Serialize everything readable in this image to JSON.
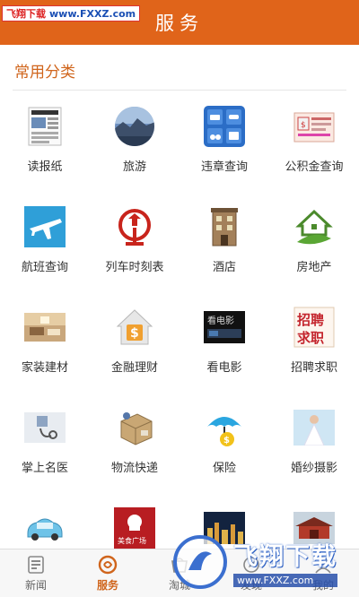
{
  "header": {
    "title": "服务"
  },
  "watermark_top": {
    "brand": "飞翔下载",
    "site": "www.FXXZ.com"
  },
  "section": {
    "title": "常用分类"
  },
  "categories": [
    {
      "label": "读报纸",
      "icon": "newspaper-icon"
    },
    {
      "label": "旅游",
      "icon": "travel-photo-icon"
    },
    {
      "label": "违章查询",
      "icon": "traffic-violation-icon"
    },
    {
      "label": "公积金查询",
      "icon": "housing-fund-icon"
    },
    {
      "label": "航班查询",
      "icon": "airplane-icon"
    },
    {
      "label": "列车时刻表",
      "icon": "railway-logo-icon"
    },
    {
      "label": "酒店",
      "icon": "hotel-building-icon"
    },
    {
      "label": "房地产",
      "icon": "house-leaf-icon"
    },
    {
      "label": "家装建材",
      "icon": "interior-room-icon"
    },
    {
      "label": "金融理财",
      "icon": "finance-house-icon"
    },
    {
      "label": "看电影",
      "icon": "movie-icon"
    },
    {
      "label": "招聘求职",
      "icon": "recruitment-icon"
    },
    {
      "label": "掌上名医",
      "icon": "medical-icon"
    },
    {
      "label": "物流快递",
      "icon": "delivery-package-icon"
    },
    {
      "label": "保险",
      "icon": "umbrella-icon"
    },
    {
      "label": "婚纱摄影",
      "icon": "wedding-photo-icon"
    },
    {
      "label": "",
      "icon": "car-icon"
    },
    {
      "label": "",
      "icon": "food-plaza-icon"
    },
    {
      "label": "",
      "icon": "night-city-icon"
    },
    {
      "label": "",
      "icon": "palace-icon"
    }
  ],
  "food_plaza_text": "美食广场",
  "bottom_nav": [
    {
      "label": "新闻",
      "icon": "news-icon",
      "active": false
    },
    {
      "label": "服务",
      "icon": "service-icon",
      "active": true
    },
    {
      "label": "淘城",
      "icon": "shop-icon",
      "active": false
    },
    {
      "label": "发现",
      "icon": "discover-icon",
      "active": false
    },
    {
      "label": "我的",
      "icon": "user-icon",
      "active": false
    }
  ],
  "watermark_bottom": {
    "brand": "飞翔下载",
    "site": "www.FXXZ.com"
  },
  "colors": {
    "accent": "#e0641a",
    "section_title": "#d0651c"
  }
}
